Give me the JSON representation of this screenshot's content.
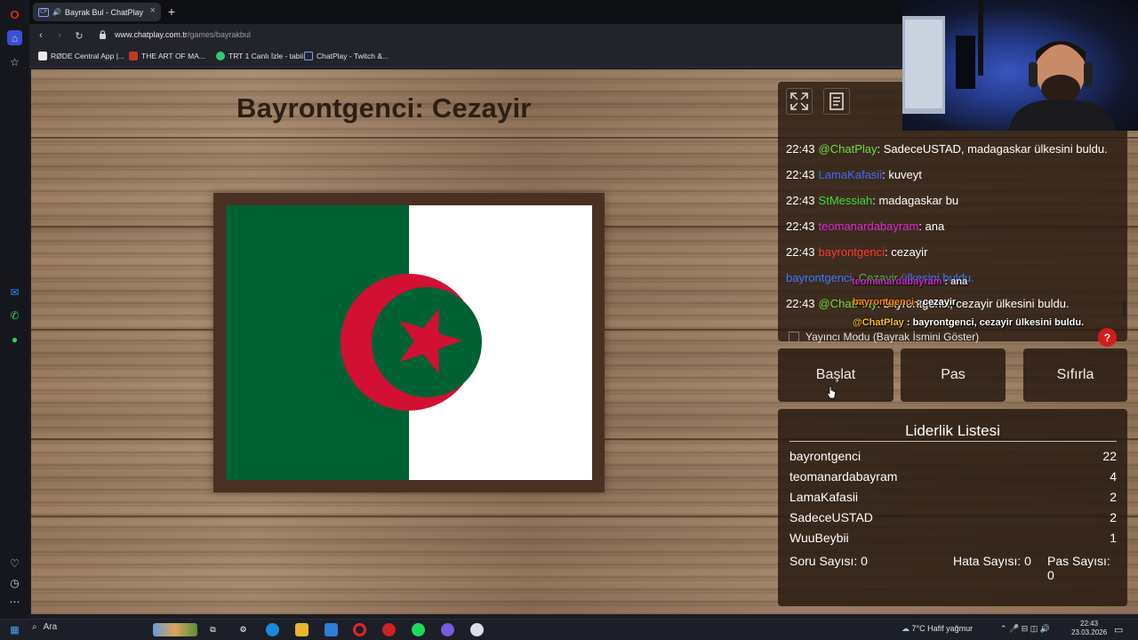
{
  "browser": {
    "tab_title": "Bayrak Bul - ChatPlay",
    "tab_favicon": "CP",
    "url_domain": "www.chatplay.com.tr",
    "url_path": "/games/bayrakbul",
    "bookmarks": [
      {
        "label": "RØDE Central App |...",
        "color": "#e8e8e8"
      },
      {
        "label": "THE ART OF MA...",
        "color": "#c0392b"
      },
      {
        "label": "TRT 1 Canlı İzle - tabii",
        "color": "#2ecc71"
      },
      {
        "label": "ChatPlay - Twitch &...",
        "color": "#8aa0ff"
      }
    ]
  },
  "game": {
    "title": "Bayrontgenci: Cezayir",
    "flag": {
      "country": "Cezayir",
      "left_color": "#006233",
      "right_color": "#ffffff",
      "emblem_color": "#d21034"
    }
  },
  "chat": {
    "messages": [
      {
        "time": "22:43",
        "user": "@ChatPlay",
        "user_color": "#6fdc3c",
        "text": ": SadeceUSTAD, madagaskar ülkesini buldu."
      },
      {
        "time": "22:43",
        "user": "LamaKafasii",
        "user_color": "#3d6bff",
        "text": ": kuveyt"
      },
      {
        "time": "22:43",
        "user": "StMessiah",
        "user_color": "#3ddc3d",
        "text": ": madagaskar bu"
      },
      {
        "time": "22:43",
        "user": "teomanardabayram",
        "user_color": "#e02ad8",
        "text": ": ana"
      },
      {
        "time": "22:43",
        "user": "bayrontgenci",
        "user_color": "#ff3b2a",
        "text": ": cezayir"
      },
      {
        "time": "",
        "user": "bayrontgenci,",
        "user_color": "#3d7bff",
        "text": " Cezayir ülkesini buldu.",
        "text_parts": [
          {
            "t": "Cezayir",
            "c": "#3dbd3d"
          },
          {
            "t": " ülkesini buldu.",
            "c": "#3d7bff"
          }
        ]
      },
      {
        "time": "22:43",
        "user": "@ChatPlay",
        "user_color": "#6fdc3c",
        "text": ": bayrontgenci, cezayir ülkesini buldu."
      }
    ],
    "streamer_mode_label": "Yayıncı Modu (Bayrak İsmini Göster)",
    "help_label": "?"
  },
  "controls": {
    "start_label": "Başlat",
    "pass_label": "Pas",
    "reset_label": "Sıfırla"
  },
  "overlay": {
    "lines": [
      {
        "user": "teomanardabayram",
        "user_color": "#e02ad8",
        "text": " : ana"
      },
      {
        "user": "bayrontgenci",
        "user_color": "#ff8a00",
        "text": " : cezayir"
      },
      {
        "user": "@ChatPlay",
        "user_color": "#f0c020",
        "text": " : bayrontgenci, cezayir ülkesini buldu."
      }
    ]
  },
  "leaderboard": {
    "title": "Liderlik Listesi",
    "rows": [
      {
        "name": "bayrontgenci",
        "score": "22"
      },
      {
        "name": "teomanardabayram",
        "score": "4"
      },
      {
        "name": "LamaKafasii",
        "score": "2"
      },
      {
        "name": "SadeceUSTAD",
        "score": "2"
      },
      {
        "name": "WuuBeybii",
        "score": "1"
      }
    ],
    "questions_label": "Soru Sayısı:",
    "questions_value": "0",
    "errors_label": "Hata Sayısı:",
    "errors_value": "0",
    "passes_label": "Pas Sayısı:",
    "passes_value": "0"
  },
  "taskbar": {
    "search_placeholder": "Ara",
    "weather": "7°C  Hafif yağmur",
    "time": "22:43",
    "date": "23.03.2026"
  }
}
